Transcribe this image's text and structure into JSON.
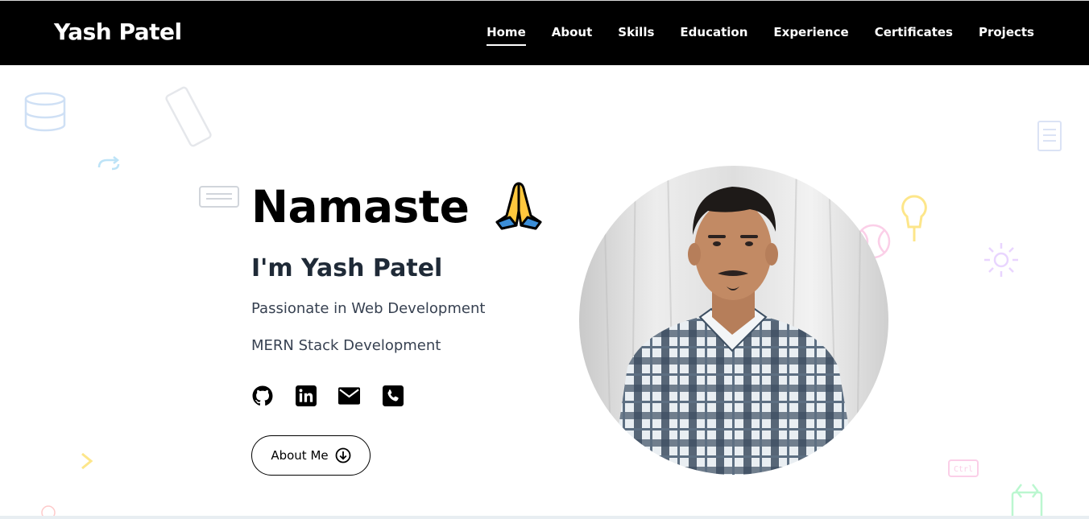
{
  "nav": {
    "brand": "Yash Patel",
    "links": [
      {
        "label": "Home",
        "active": true
      },
      {
        "label": "About",
        "active": false
      },
      {
        "label": "Skills",
        "active": false
      },
      {
        "label": "Education",
        "active": false
      },
      {
        "label": "Experience",
        "active": false
      },
      {
        "label": "Certificates",
        "active": false
      },
      {
        "label": "Projects",
        "active": false
      }
    ]
  },
  "hero": {
    "greeting": "Namaste",
    "greeting_icon": "folded-hands-icon",
    "intro": "I'm Yash Patel",
    "line1": "Passionate in Web Development",
    "line2": "MERN Stack Development",
    "social": [
      {
        "icon": "github-icon"
      },
      {
        "icon": "linkedin-icon"
      },
      {
        "icon": "mail-icon"
      },
      {
        "icon": "phone-icon"
      }
    ],
    "about_button": "About Me",
    "avatar_icon": "profile-photo"
  },
  "colors": {
    "nav_bg": "#000000",
    "text": "#000000",
    "subtext": "#374151"
  }
}
